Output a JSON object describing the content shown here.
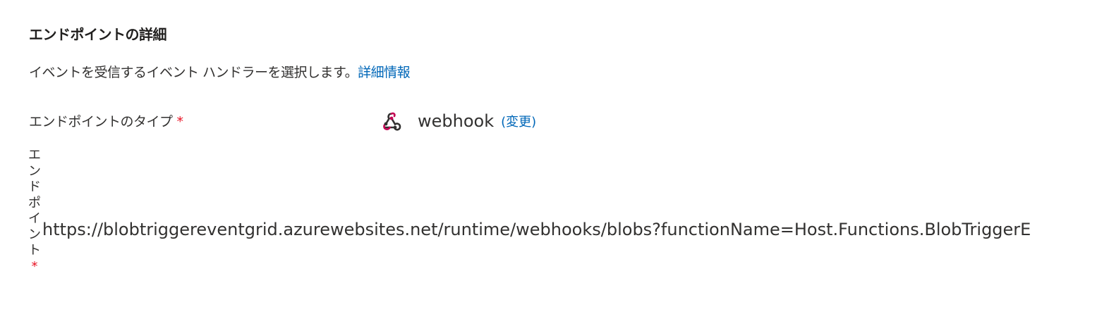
{
  "section": {
    "title": "エンドポイントの詳細",
    "description": "イベントを受信するイベント ハンドラーを選択します。",
    "learn_more_link": "詳細情報"
  },
  "endpoint_type": {
    "label": "エンドポイントのタイプ",
    "required_marker": "*",
    "value": "webhook",
    "value_icon": "webhook-icon",
    "change_link": "(変更)"
  },
  "endpoint": {
    "label": "エンドポイント",
    "required_marker": "*",
    "value": "https://blobtriggereventgrid.azurewebsites.net/runtime/webhooks/blobs?functionName=Host.Functions.BlobTriggerE"
  },
  "colors": {
    "link": "#0067b8",
    "required": "#e81123",
    "text": "#323130",
    "icon_dark": "#323130",
    "icon_accent": "#c30052"
  }
}
